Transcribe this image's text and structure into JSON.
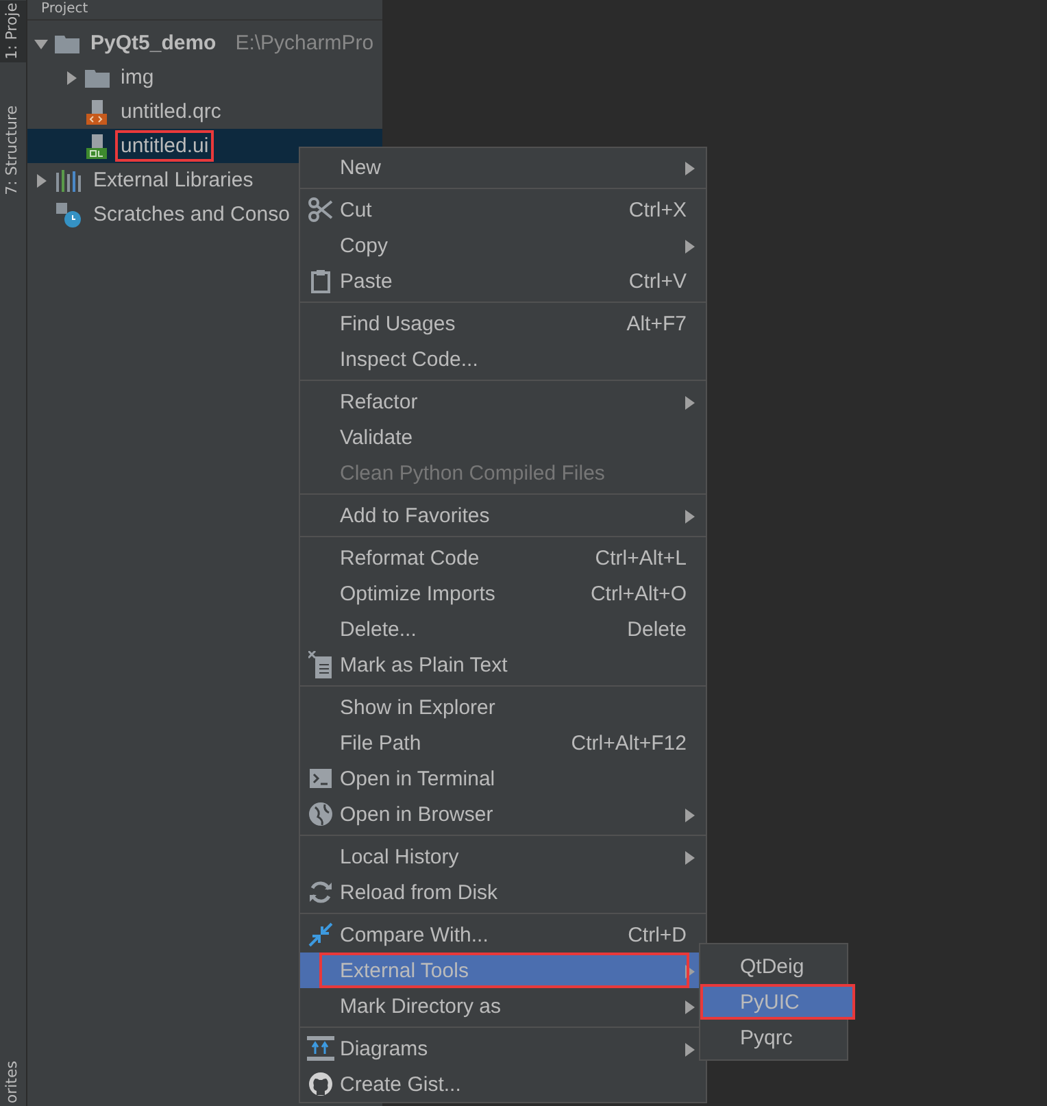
{
  "side_tabs": [
    {
      "label": "1: Proje",
      "selected": true
    },
    {
      "label": "7: Structure",
      "selected": false
    }
  ],
  "side_tabs_bottom": [
    {
      "label": "orites",
      "selected": false
    }
  ],
  "project_panel": {
    "title": "Project",
    "tree": [
      {
        "label": "PyQt5_demo",
        "path": "E:\\PycharmPro",
        "kind": "folder",
        "expanded": true,
        "selected": false,
        "marked": false,
        "children": [
          {
            "label": "img",
            "kind": "folder",
            "expanded": false,
            "selected": false,
            "marked": false
          },
          {
            "label": "untitled.qrc",
            "kind": "qrc",
            "selected": false,
            "marked": false
          },
          {
            "label": "untitled.ui",
            "kind": "ui",
            "selected": true,
            "marked": true
          }
        ]
      },
      {
        "label": "External Libraries",
        "kind": "libraries",
        "expanded": false,
        "selected": false,
        "marked": false
      },
      {
        "label": "Scratches and Conso",
        "kind": "scratches",
        "selected": false,
        "marked": false
      }
    ]
  },
  "context_menu": {
    "groups": [
      [
        {
          "label": "New",
          "submenu": true,
          "disabled": false,
          "selected": false,
          "marked": false
        }
      ],
      [
        {
          "label": "Cut",
          "shortcut": "Ctrl+X",
          "submenu": false,
          "disabled": false,
          "selected": false,
          "marked": false
        },
        {
          "label": "Copy",
          "submenu": true,
          "disabled": false,
          "selected": false,
          "marked": false
        },
        {
          "label": "Paste",
          "shortcut": "Ctrl+V",
          "submenu": false,
          "disabled": false,
          "selected": false,
          "marked": false
        }
      ],
      [
        {
          "label": "Find Usages",
          "shortcut": "Alt+F7",
          "submenu": false,
          "disabled": false,
          "selected": false,
          "marked": false
        },
        {
          "label": "Inspect Code...",
          "submenu": false,
          "disabled": false,
          "selected": false,
          "marked": false
        }
      ],
      [
        {
          "label": "Refactor",
          "submenu": true,
          "disabled": false,
          "selected": false,
          "marked": false
        },
        {
          "label": "Validate",
          "submenu": false,
          "disabled": false,
          "selected": false,
          "marked": false
        },
        {
          "label": "Clean Python Compiled Files",
          "submenu": false,
          "disabled": true,
          "selected": false,
          "marked": false
        }
      ],
      [
        {
          "label": "Add to Favorites",
          "submenu": true,
          "disabled": false,
          "selected": false,
          "marked": false
        }
      ],
      [
        {
          "label": "Reformat Code",
          "shortcut": "Ctrl+Alt+L",
          "submenu": false,
          "disabled": false,
          "selected": false,
          "marked": false
        },
        {
          "label": "Optimize Imports",
          "shortcut": "Ctrl+Alt+O",
          "submenu": false,
          "disabled": false,
          "selected": false,
          "marked": false
        },
        {
          "label": "Delete...",
          "shortcut": "Delete",
          "submenu": false,
          "disabled": false,
          "selected": false,
          "marked": false
        },
        {
          "label": "Mark as Plain Text",
          "submenu": false,
          "disabled": false,
          "selected": false,
          "marked": false
        }
      ],
      [
        {
          "label": "Show in Explorer",
          "submenu": false,
          "disabled": false,
          "selected": false,
          "marked": false
        },
        {
          "label": "File Path",
          "shortcut": "Ctrl+Alt+F12",
          "submenu": false,
          "disabled": false,
          "selected": false,
          "marked": false
        },
        {
          "label": "Open in Terminal",
          "submenu": false,
          "disabled": false,
          "selected": false,
          "marked": false
        },
        {
          "label": "Open in Browser",
          "submenu": true,
          "disabled": false,
          "selected": false,
          "marked": false
        }
      ],
      [
        {
          "label": "Local History",
          "submenu": true,
          "disabled": false,
          "selected": false,
          "marked": false
        },
        {
          "label": "Reload from Disk",
          "submenu": false,
          "disabled": false,
          "selected": false,
          "marked": false
        }
      ],
      [
        {
          "label": "Compare With...",
          "shortcut": "Ctrl+D",
          "submenu": false,
          "disabled": false,
          "selected": false,
          "marked": false
        },
        {
          "label": "External Tools",
          "submenu": true,
          "disabled": false,
          "selected": true,
          "marked": true
        },
        {
          "label": "Mark Directory as",
          "submenu": true,
          "disabled": false,
          "selected": false,
          "marked": false
        }
      ],
      [
        {
          "label": "Diagrams",
          "submenu": true,
          "disabled": false,
          "selected": false,
          "marked": false
        },
        {
          "label": "Create Gist...",
          "submenu": false,
          "disabled": false,
          "selected": false,
          "marked": false
        }
      ]
    ]
  },
  "submenu": {
    "items": [
      {
        "label": "QtDeig",
        "selected": false,
        "marked": false
      },
      {
        "label": "PyUIC",
        "selected": true,
        "marked": true
      },
      {
        "label": "Pyqrc",
        "selected": false,
        "marked": false
      }
    ]
  }
}
